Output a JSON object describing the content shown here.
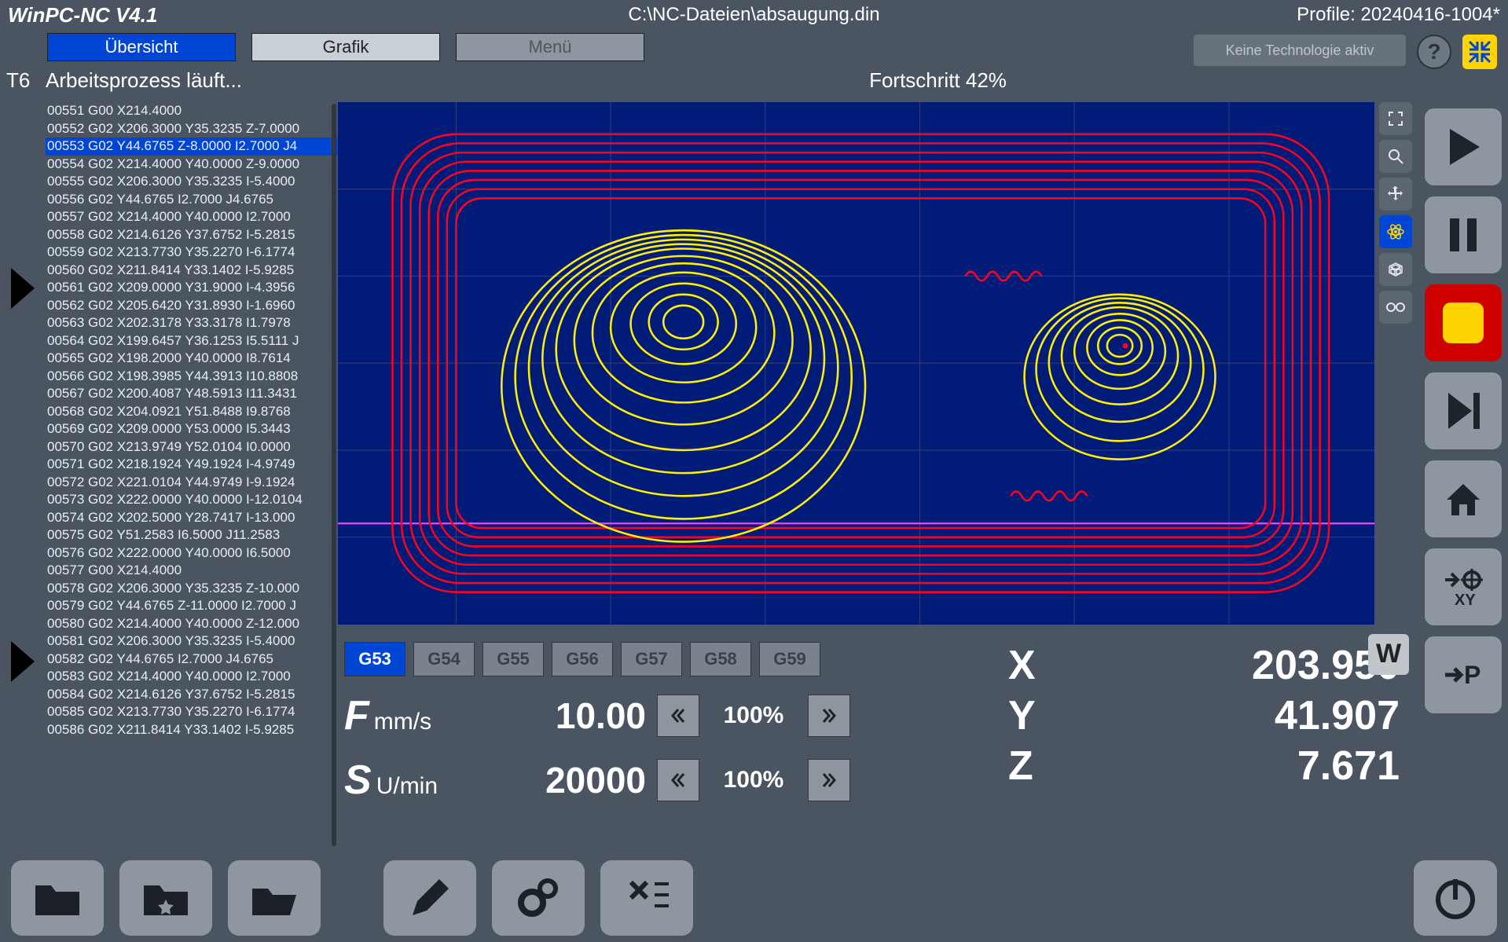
{
  "app_title": "WinPC-NC V4.1",
  "file_path": "C:\\NC-Dateien\\absaugung.din",
  "profile": "Profile: 20240416-1004*",
  "tabs": {
    "overview": "Übersicht",
    "graphic": "Grafik",
    "menu": "Menü"
  },
  "tech_status": "Keine Technologie aktiv",
  "t_label": "T6",
  "work_status": "Arbeitsprozess läuft...",
  "progress": "Fortschritt 42%",
  "gcode": [
    "00551  G00 X214.4000",
    "00552  G02 X206.3000 Y35.3235 Z-7.0000",
    "00553  G02 Y44.6765 Z-8.0000 I2.7000 J4",
    "00554  G02 X214.4000 Y40.0000 Z-9.0000",
    "00555  G02 X206.3000 Y35.3235 I-5.4000",
    "00556  G02 Y44.6765 I2.7000 J4.6765",
    "00557  G02 X214.4000 Y40.0000 I2.7000",
    "00558  G02 X214.6126 Y37.6752 I-5.2815",
    "00559  G02 X213.7730 Y35.2270 I-6.1774",
    "00560  G02 X211.8414 Y33.1402 I-5.9285",
    "00561  G02 X209.0000 Y31.9000 I-4.3956",
    "00562  G02 X205.6420 Y31.8930 I-1.6960",
    "00563  G02 X202.3178 Y33.3178 I1.7978",
    "00564  G02 X199.6457 Y36.1253 I5.5111 J",
    "00565  G02 X198.2000 Y40.0000 I8.7614",
    "00566  G02 X198.3985 Y44.3913 I10.8808",
    "00567  G02 X200.4087 Y48.5913 I11.3431",
    "00568  G02 X204.0921 Y51.8488 I9.8768",
    "00569  G02 X209.0000 Y53.0000 I5.3443",
    "00570  G02 X213.9749 Y52.0104 I0.0000",
    "00571  G02 X218.1924 Y49.1924 I-4.9749",
    "00572  G02 X221.0104 Y44.9749 I-9.1924",
    "00573  G02 X222.0000 Y40.0000 I-12.0104",
    "00574  G02 X202.5000 Y28.7417 I-13.000",
    "00575  G02 Y51.2583 I6.5000 J11.2583",
    "00576  G02 X222.0000 Y40.0000 I6.5000",
    "00577  G00 X214.4000",
    "00578  G02 X206.3000 Y35.3235 Z-10.000",
    "00579  G02 Y44.6765 Z-11.0000 I2.7000 J",
    "00580  G02 X214.4000 Y40.0000 Z-12.000",
    "00581  G02 X206.3000 Y35.3235 I-5.4000",
    "00582  G02 Y44.6765 I2.7000 J4.6765",
    "00583  G02 X214.4000 Y40.0000 I2.7000",
    "00584  G02 X214.6126 Y37.6752 I-5.2815",
    "00585  G02 X213.7730 Y35.2270 I-6.1774",
    "00586  G02 X211.8414 Y33.1402 I-5.9285"
  ],
  "gcode_selected": 2,
  "g5x": [
    "G53",
    "G54",
    "G55",
    "G56",
    "G57",
    "G58",
    "G59"
  ],
  "g5x_active": 0,
  "feed": {
    "big": "F",
    "unit": "mm/s",
    "value": "10.00",
    "pct": "100%"
  },
  "spindle": {
    "big": "S",
    "unit": "U/min",
    "value": "20000",
    "pct": "100%"
  },
  "coords": {
    "x_label": "X",
    "x": "203.950",
    "y_label": "Y",
    "y": "41.907",
    "z_label": "Z",
    "z": "7.671"
  },
  "w_label": "W"
}
